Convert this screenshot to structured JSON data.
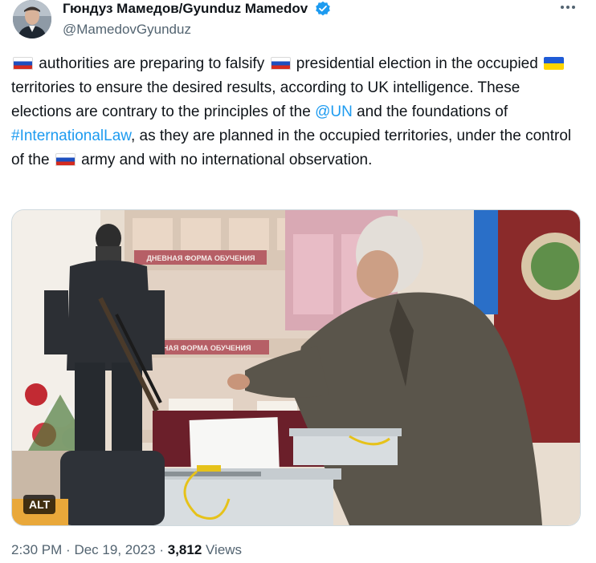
{
  "author": {
    "display_name": "Гюндуз Мамедов/Gyunduz Mamedov",
    "handle": "@MamedovGyunduz",
    "verified": true
  },
  "more_icon": "more-horizontal-icon",
  "tweet": {
    "segments": [
      {
        "type": "flag",
        "country": "RU"
      },
      {
        "type": "text",
        "text": " authorities are preparing to falsify "
      },
      {
        "type": "flag",
        "country": "RU"
      },
      {
        "type": "text",
        "text": " presidential election in the occupied "
      },
      {
        "type": "flag",
        "country": "UA"
      },
      {
        "type": "text",
        "text": " territories to ensure the desired results, according to UK intelligence. These elections are contrary to the principles of the "
      },
      {
        "type": "link",
        "text": "@UN"
      },
      {
        "type": "text",
        "text": " and the foundations of "
      },
      {
        "type": "link",
        "text": "#InternationalLaw"
      },
      {
        "type": "text",
        "text": ", as they are planned in the occupied territories, under the control of the "
      },
      {
        "type": "flag",
        "country": "RU"
      },
      {
        "type": "text",
        "text": " army and with no international observation."
      }
    ]
  },
  "media": {
    "alt_badge": "ALT",
    "sign_top": "ДНЕВНАЯ ФОРМА ОБУЧЕНИЯ",
    "sign_bottom": "ОЧНАЯ ФОРМА ОБУЧЕНИЯ"
  },
  "meta": {
    "time": "2:30 PM",
    "separator": "·",
    "date": "Dec 19, 2023",
    "views_count": "3,812",
    "views_label": "Views"
  },
  "colors": {
    "link": "#1d9bf0",
    "secondary_text": "#536471",
    "verified_badge": "#1d9bf0"
  }
}
